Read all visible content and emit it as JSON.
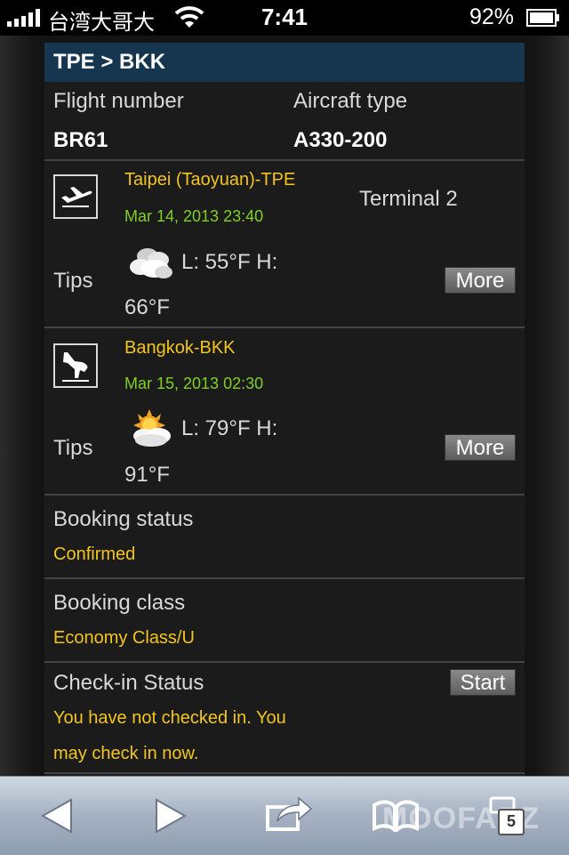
{
  "status_bar": {
    "carrier": "台湾大哥大",
    "time": "7:41",
    "battery": "92%"
  },
  "header": {
    "route": "TPE > BKK"
  },
  "flight": {
    "number_label": "Flight number",
    "number": "BR61",
    "aircraft_label": "Aircraft type",
    "aircraft": "A330-200"
  },
  "departure": {
    "airport": "Taipei (Taoyuan)-TPE",
    "datetime": "Mar 14, 2013 23:40",
    "terminal": "Terminal 2",
    "tips_label": "Tips",
    "temp_line1": "L: 55°F  H:",
    "temp_line2": "66°F",
    "more_label": "More",
    "icon": "plane-takeoff-icon",
    "weather_icon": "cloudy-icon"
  },
  "arrival": {
    "airport": "Bangkok-BKK",
    "datetime": "Mar 15, 2013 02:30",
    "tips_label": "Tips",
    "temp_line1": "L: 79°F  H:",
    "temp_line2": "91°F",
    "more_label": "More",
    "icon": "plane-landing-icon",
    "weather_icon": "partly-cloudy-icon"
  },
  "booking_status": {
    "label": "Booking status",
    "value": "Confirmed"
  },
  "booking_class": {
    "label": "Booking class",
    "value": "Economy Class/U"
  },
  "checkin": {
    "label": "Check-in Status",
    "start_label": "Start",
    "message_line1": "You have not checked in. You",
    "message_line2": "may check in now."
  },
  "toolbar": {
    "tabs_count": "5",
    "watermark": "MOOFARZ"
  },
  "colors": {
    "accent_yellow": "#f3c51f",
    "date_green": "#7fcf24",
    "header_blue": "#15364e"
  }
}
